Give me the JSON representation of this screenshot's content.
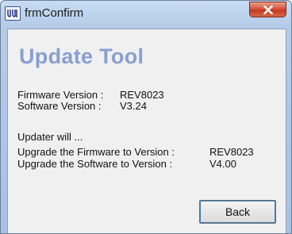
{
  "window": {
    "title": "frmConfirm",
    "icon": "app-logo-icon",
    "close_icon": "close-icon"
  },
  "heading": "Update Tool",
  "current": {
    "firmware_label": "Firmware Version :",
    "firmware_value": "REV8023",
    "software_label": "Software Version :",
    "software_value": "V3.24"
  },
  "updater": {
    "intro": "Updater will ...",
    "firmware_label": "Upgrade the Firmware to Version :",
    "firmware_value": "REV8023",
    "software_label": "Upgrade the Software to Version :",
    "software_value": "V4.00"
  },
  "buttons": {
    "back_label": "Back"
  },
  "colors": {
    "heading": "#8a9fcf",
    "close_button": "#c23a1f",
    "frame": "#b4cbe8"
  }
}
